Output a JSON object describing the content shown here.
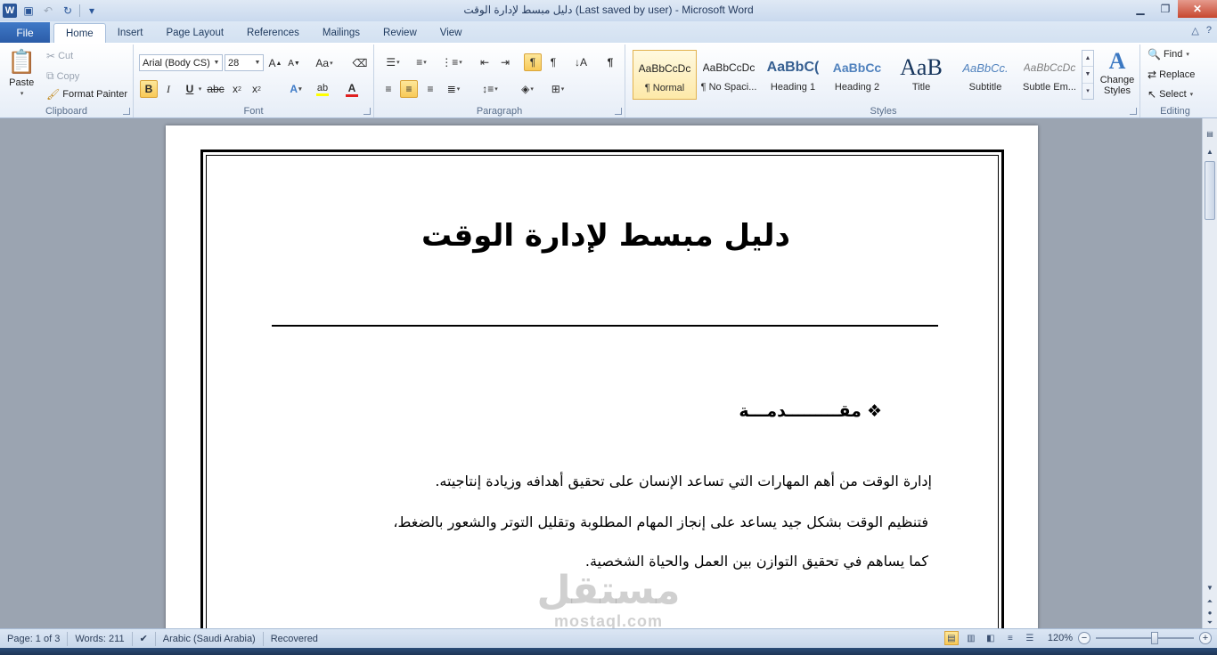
{
  "window": {
    "title": "دليل مبسط لإدارة الوقت (Last saved by user)  -  Microsoft Word",
    "app_logo": "W",
    "controls": [
      "minimize",
      "restore",
      "close"
    ]
  },
  "tabs": [
    {
      "label": "File"
    },
    {
      "label": "Home"
    },
    {
      "label": "Insert"
    },
    {
      "label": "Page Layout"
    },
    {
      "label": "References"
    },
    {
      "label": "Mailings"
    },
    {
      "label": "Review"
    },
    {
      "label": "View"
    }
  ],
  "ribbon": {
    "clipboard": {
      "label": "Clipboard",
      "paste": "Paste",
      "cut": "Cut",
      "copy": "Copy",
      "format_painter": "Format Painter"
    },
    "font": {
      "label": "Font",
      "font_name": "Arial (Body CS)",
      "font_size": "28"
    },
    "paragraph": {
      "label": "Paragraph"
    },
    "styles": {
      "label": "Styles",
      "items": [
        {
          "sample": "AaBbCcDc",
          "name": "¶ Normal"
        },
        {
          "sample": "AaBbCcDc",
          "name": "¶ No Spaci..."
        },
        {
          "sample": "AaBbC(",
          "name": "Heading 1"
        },
        {
          "sample": "AaBbCc",
          "name": "Heading 2"
        },
        {
          "sample": "AaB",
          "name": "Title"
        },
        {
          "sample": "AaBbCc.",
          "name": "Subtitle"
        },
        {
          "sample": "AaBbCcDc",
          "name": "Subtle Em..."
        }
      ],
      "change_styles": "Change Styles"
    },
    "editing": {
      "label": "Editing",
      "find": "Find",
      "replace": "Replace",
      "select": "Select"
    }
  },
  "document": {
    "title": "دليل مبسط لإدارة الوقت",
    "heading_bullet": "❖",
    "heading": "مقـــــــــدمـــة",
    "paragraphs": [
      "إدارة الوقت من أهم المهارات التي تساعد الإنسان على تحقيق أهدافه وزيادة إنتاجيته.",
      "فتنظيم الوقت بشكل جيد يساعد على إنجاز المهام المطلوبة وتقليل التوتر والشعور بالضغط،",
      "كما يساهم في تحقيق التوازن بين العمل والحياة الشخصية."
    ],
    "watermark_text": "مستقل",
    "watermark_url": "mostaql.com"
  },
  "status": {
    "page": "Page: 1 of 3",
    "words": "Words: 211",
    "language": "Arabic (Saudi Arabia)",
    "state": "Recovered",
    "zoom": "120%",
    "zoom_fraction": 0.6
  },
  "colors": {
    "accent": "#2b5ca8",
    "highlight": "#f8c957",
    "font_color_bar": "#e02020",
    "highlight_bar": "#ffff00"
  }
}
